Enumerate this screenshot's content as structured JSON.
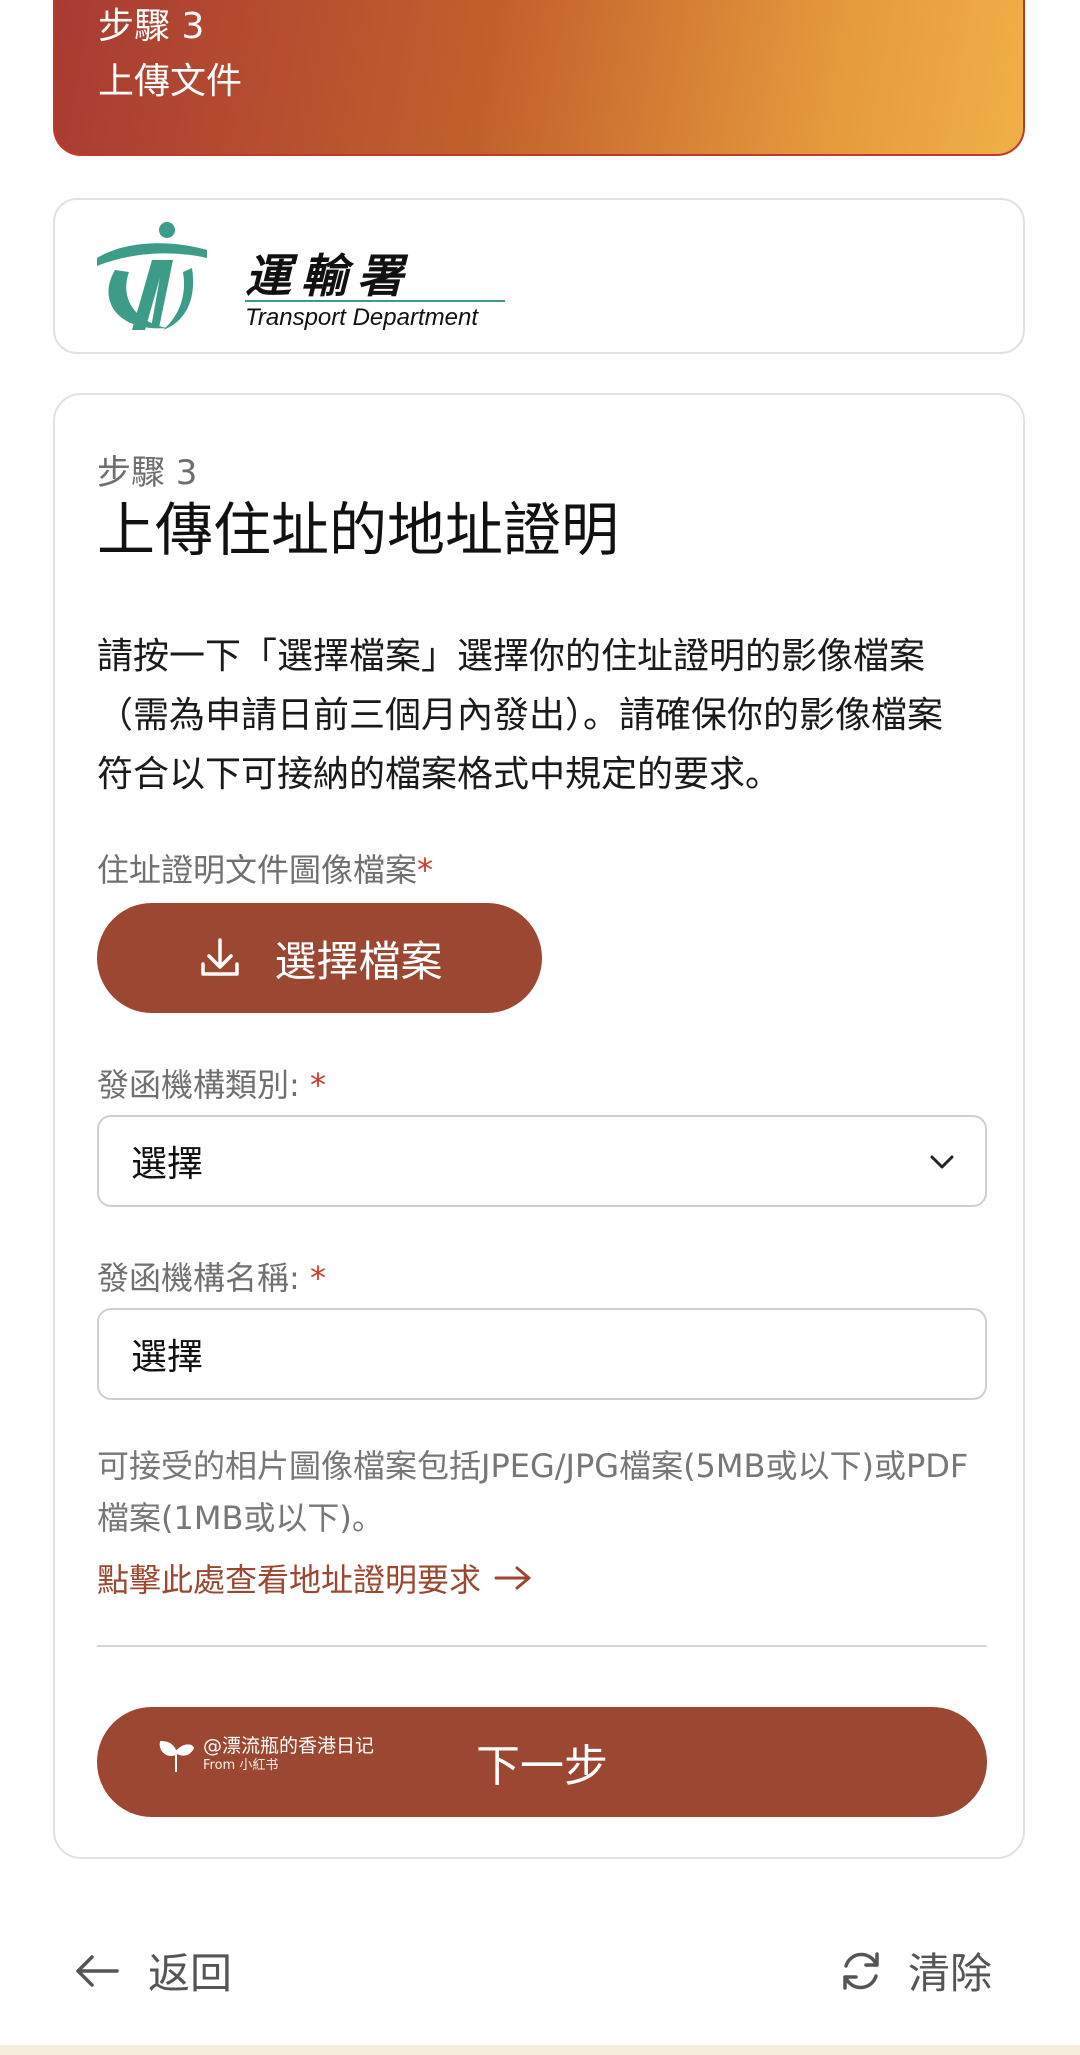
{
  "header": {
    "step": "步驟 3",
    "title": "上傳文件"
  },
  "logo": {
    "zh": "運輸署",
    "en": "Transport Department",
    "accent_color": "#3c9c87"
  },
  "main": {
    "step": "步驟 3",
    "title": "上傳住址的地址證明",
    "description": "請按一下「選擇檔案」選擇你的住址證明的影像檔案（需為申請日前三個月內發出）。請確保你的影像檔案符合以下可接納的檔案格式中規定的要求。",
    "file_field": {
      "label": "住址證明文件圖像檔案",
      "required_mark": "*",
      "button_label": "選擇檔案",
      "button_icon": "download-icon"
    },
    "org_type": {
      "label": "發函機構類別: ",
      "required_mark": "*",
      "value": "選擇"
    },
    "org_name": {
      "label": "發函機構名稱: ",
      "required_mark": "*",
      "value": "選擇"
    },
    "note": "可接受的相片圖像檔案包括JPEG/JPG檔案(5MB或以下)或PDF檔案(1MB或以下)。",
    "link": "點擊此處查看地址證明要求",
    "next_button": "下一步",
    "watermark": {
      "handle": "@漂流瓶的香港日记",
      "source": "From 小紅书"
    }
  },
  "footer": {
    "back": "返回",
    "clear": "清除"
  },
  "colors": {
    "primary": "#9b4731",
    "required": "#d0392b",
    "header_start": "#a83a33",
    "header_end": "#f0b047"
  }
}
